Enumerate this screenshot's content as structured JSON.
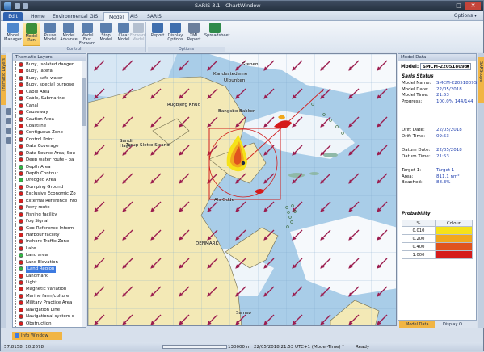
{
  "window": {
    "title": "SARIS 3.1 - ChartWindow",
    "minimize": "–",
    "maximize": "□",
    "close": "✕"
  },
  "menu": {
    "tabs": [
      "Edit",
      "Home",
      "Environmental",
      "GIS",
      "Model",
      "AIS",
      "SARIS"
    ],
    "active": "Model",
    "options": "Options ▾"
  },
  "ribbon": {
    "groups": [
      {
        "label": "Control",
        "buttons": [
          "Model Manager",
          "Model Run",
          "Pause Model",
          "Model Advance",
          "Model Fast Forward",
          "Stop Model",
          "Clear Model",
          "Forward Model"
        ]
      },
      {
        "label": "Options",
        "buttons": [
          "Report",
          "Display Options",
          "XML Report",
          "Spreadsheet"
        ]
      }
    ]
  },
  "left_dock": {
    "thematic_tab": "Thematic Layers"
  },
  "thematic": {
    "title": "Thematic Layers",
    "layers": [
      {
        "label": "Buoy, isolated danger",
        "color": "#d81e1e"
      },
      {
        "label": "Buoy, lateral",
        "color": "#d81e1e"
      },
      {
        "label": "Buoy, safe water",
        "color": "#d81e1e"
      },
      {
        "label": "Buoy, special purpose",
        "color": "#d81e1e"
      },
      {
        "label": "Cable Area",
        "color": "#d81e1e"
      },
      {
        "label": "Cable, Submarine",
        "color": "#d81e1e"
      },
      {
        "label": "Canal",
        "color": "#d81e1e"
      },
      {
        "label": "Causeway",
        "color": "#d81e1e"
      },
      {
        "label": "Caution Area",
        "color": "#d81e1e"
      },
      {
        "label": "Coastline",
        "color": "#d81e1e"
      },
      {
        "label": "Contiguous Zone",
        "color": "#d81e1e"
      },
      {
        "label": "Control Point",
        "color": "#d81e1e"
      },
      {
        "label": "Data Coverage",
        "color": "#d81e1e"
      },
      {
        "label": "Data Source Area; Sou",
        "color": "#d81e1e"
      },
      {
        "label": "Deep water route - pa",
        "color": "#d81e1e"
      },
      {
        "label": "Depth Area",
        "color": "#31b845"
      },
      {
        "label": "Depth Contour",
        "color": "#d81e1e"
      },
      {
        "label": "Dredged Area",
        "color": "#31b845"
      },
      {
        "label": "Dumping Ground",
        "color": "#d81e1e"
      },
      {
        "label": "Exclusive Economic Zo",
        "color": "#d81e1e"
      },
      {
        "label": "External Reference Info",
        "color": "#d81e1e"
      },
      {
        "label": "Ferry route",
        "color": "#d81e1e"
      },
      {
        "label": "Fishing facility",
        "color": "#d81e1e"
      },
      {
        "label": "Fog Signal",
        "color": "#d81e1e"
      },
      {
        "label": "Geo-Reference Inform",
        "color": "#d81e1e"
      },
      {
        "label": "Harbour facility",
        "color": "#d81e1e"
      },
      {
        "label": "Inshore Traffic Zone",
        "color": "#d81e1e"
      },
      {
        "label": "Lake",
        "color": "#d81e1e"
      },
      {
        "label": "Land area",
        "color": "#31b845"
      },
      {
        "label": "Land Elevation",
        "color": "#d81e1e"
      },
      {
        "label": "Land Region",
        "color": "#31b845",
        "selected": true
      },
      {
        "label": "Landmark",
        "color": "#d81e1e"
      },
      {
        "label": "Light",
        "color": "#d81e1e"
      },
      {
        "label": "Magnetic variation",
        "color": "#d81e1e"
      },
      {
        "label": "Marine farm/culture",
        "color": "#d81e1e"
      },
      {
        "label": "Military Practice Area",
        "color": "#d81e1e"
      },
      {
        "label": "Navigation Line",
        "color": "#d81e1e"
      },
      {
        "label": "Navigational system o",
        "color": "#d81e1e"
      },
      {
        "label": "Obstruction",
        "color": "#d81e1e"
      }
    ]
  },
  "map": {
    "labels": {
      "gronen": "Grenen",
      "kandestederne": "Kandestederne",
      "ulbunken": "Ulbunken",
      "rugbjerg": "Rugbjerg Knud",
      "bangsbo": "Bangsbo Bakker",
      "sandhage": "Sandi\nHage",
      "torup": "Torup Slette Strand",
      "als": "Als Odde",
      "denmark": "DENMARK",
      "samso": "Samsø"
    }
  },
  "model_data": {
    "title": "Model Data",
    "model_label": "Model:",
    "model_value": "SMCM-220518095",
    "saris_status": "Saris Status",
    "fields": [
      {
        "k": "Model Name:",
        "v": "SMCM-22051809S"
      },
      {
        "k": "Model Date:",
        "v": "22/05/2018"
      },
      {
        "k": "Model Time:",
        "v": "21:53"
      },
      {
        "k": "Progress:",
        "v": "100.0% 144/144"
      }
    ],
    "drift": [
      {
        "k": "Drift Date:",
        "v": "22/05/2018"
      },
      {
        "k": "Drift Time:",
        "v": "09:53"
      }
    ],
    "datum": [
      {
        "k": "Datum Date:",
        "v": "22/05/2018"
      },
      {
        "k": "Datum Time:",
        "v": "21:53"
      }
    ],
    "target": [
      {
        "k": "Target 1:",
        "v": "Target 1"
      },
      {
        "k": "Area:",
        "v": "811.1 nm²"
      },
      {
        "k": "Beached:",
        "v": "88.3%"
      }
    ],
    "probability_title": "Probability",
    "prob_headers": [
      "%",
      "Colour"
    ],
    "prob_rows": [
      {
        "pct": "0.010",
        "color": "#f5e21a"
      },
      {
        "pct": "0.200",
        "color": "#f1a81d"
      },
      {
        "pct": "0.400",
        "color": "#e0541e"
      },
      {
        "pct": "1.000",
        "color": "#d51b1b"
      }
    ]
  },
  "right_dock": {
    "tab": "SARScope"
  },
  "bottom_tabs": [
    "Model Data",
    "Display O..."
  ],
  "info_window": "Info Window",
  "status": {
    "coords": "57.8158, 10.2678",
    "scale": "130000 m",
    "datetime": "22/05/2018 21:53 UTC+1 (Model-Time) *",
    "ready": "Ready"
  },
  "colors": {
    "land": "#f3e9b6",
    "shallow": "#a9cde8",
    "deep": "#ffffff",
    "arrow": "#9b1d4f"
  }
}
